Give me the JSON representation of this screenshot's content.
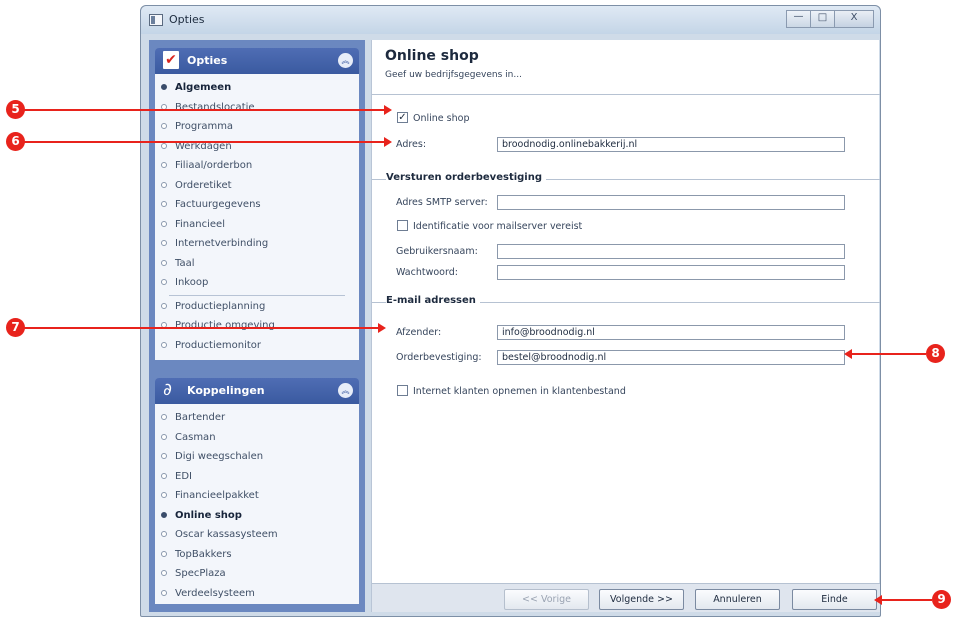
{
  "window": {
    "title": "Opties",
    "minimize_glyph": "—",
    "maximize_glyph": "□",
    "close_glyph": "X"
  },
  "sidebar": {
    "opties_group": {
      "title": "Opties",
      "icon": "checklist-icon",
      "items": [
        {
          "label": "Algemeen",
          "active": true
        },
        {
          "label": "Bestandslocatie"
        },
        {
          "label": "Programma"
        },
        {
          "label": "Werkdagen"
        },
        {
          "label": "Filiaal/orderbon"
        },
        {
          "label": "Orderetiket"
        },
        {
          "label": "Factuurgegevens"
        },
        {
          "label": "Financieel"
        },
        {
          "label": "Internetverbinding"
        },
        {
          "label": "Taal"
        },
        {
          "label": "Inkoop"
        },
        {
          "label": "Productieplanning"
        },
        {
          "label": "Productie omgeving"
        },
        {
          "label": "Productiemonitor"
        }
      ]
    },
    "koppelingen_group": {
      "title": "Koppelingen",
      "icon": "link-icon",
      "items": [
        {
          "label": "Bartender"
        },
        {
          "label": "Casman"
        },
        {
          "label": "Digi weegschalen"
        },
        {
          "label": "EDI"
        },
        {
          "label": "Financieelpakket"
        },
        {
          "label": "Online shop",
          "active": true
        },
        {
          "label": "Oscar kassasysteem"
        },
        {
          "label": "TopBakkers"
        },
        {
          "label": "SpecPlaza"
        },
        {
          "label": "Verdeelsysteem"
        }
      ]
    }
  },
  "main": {
    "title": "Online shop",
    "subtitle": "Geef uw bedrijfsgegevens in...",
    "online_shop_checkbox": {
      "label": "Online shop",
      "checked": true,
      "mark": "✓"
    },
    "adres": {
      "label": "Adres:",
      "value": "broodnodig.onlinebakkerij.nl"
    },
    "section_orderbevestiging": {
      "title": "Versturen orderbevestiging",
      "smtp": {
        "label": "Adres SMTP server:",
        "value": ""
      },
      "identificatie_checkbox": {
        "label": "Identificatie voor mailserver vereist",
        "checked": false
      },
      "gebruikersnaam": {
        "label": "Gebruikersnaam:",
        "value": ""
      },
      "wachtwoord": {
        "label": "Wachtwoord:",
        "value": ""
      }
    },
    "section_email": {
      "title": "E-mail adressen",
      "afzender": {
        "label": "Afzender:",
        "value": "info@broodnodig.nl"
      },
      "orderbevestiging": {
        "label": "Orderbevestiging:",
        "value": "bestel@broodnodig.nl"
      },
      "internet_klanten_checkbox": {
        "label": "Internet klanten opnemen in klantenbestand",
        "checked": false
      }
    }
  },
  "footer": {
    "prev": {
      "label": "<< Vorige",
      "enabled": false
    },
    "next": {
      "label": "Volgende >>"
    },
    "cancel": {
      "label": "Annuleren"
    },
    "finish": {
      "label": "Einde"
    }
  },
  "callouts": [
    "5",
    "6",
    "7",
    "8",
    "9"
  ],
  "colors": {
    "sidebar_bg": "#6b88c0",
    "group_header": "#3a5aa0",
    "callout": "#e8231c"
  }
}
